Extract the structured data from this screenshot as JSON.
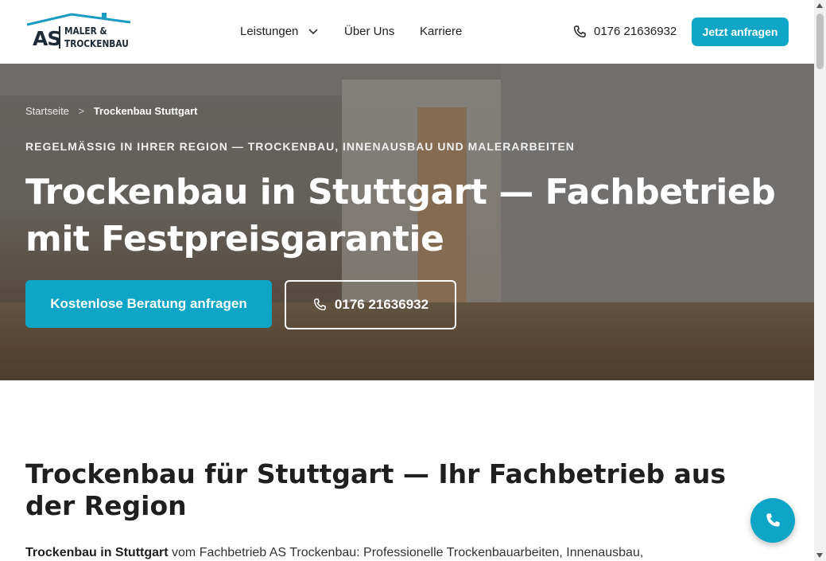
{
  "logo": {
    "initials": "AS",
    "line1": "MALER &",
    "line2": "TROCKENBAU"
  },
  "nav": {
    "items": [
      {
        "label": "Leistungen",
        "has_dropdown": true
      },
      {
        "label": "Über Uns"
      },
      {
        "label": "Karriere"
      }
    ],
    "phone": "0176 21636932",
    "cta": "Jetzt anfragen"
  },
  "hero": {
    "breadcrumb": {
      "home": "Startseite",
      "separator": ">",
      "current": "Trockenbau Stuttgart"
    },
    "eyebrow": "REGELMÄSSIG IN IHRER REGION — TROCKENBAU, INNENAUSBAU UND MALERARBEITEN",
    "title": "Trockenbau in Stuttgart — Fachbetrieb mit Festpreisgarantie",
    "primary_button": "Kostenlose Beratung anfragen",
    "phone_button": "0176 21636932"
  },
  "content": {
    "section_title": "Trockenbau für Stuttgart — Ihr Fachbetrieb aus der Region",
    "intro_bold": "Trockenbau in Stuttgart",
    "intro_rest": " vom Fachbetrieb AS Trockenbau: Professionelle Trockenbauarbeiten, Innenausbau,"
  },
  "colors": {
    "accent": "#0ea5c6",
    "text_dark": "#1f1f1f",
    "logo_dark": "#1f2a37"
  },
  "icons": {
    "phone": "phone-icon",
    "chevron": "chevron-down-icon",
    "float_call": "phone-icon"
  }
}
